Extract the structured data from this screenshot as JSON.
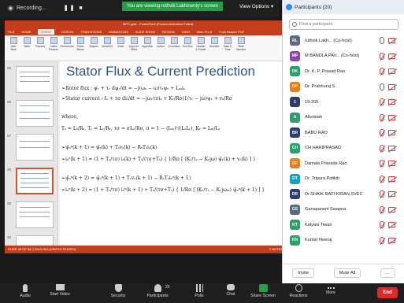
{
  "topbar": {
    "recording_label": "Recording...",
    "pause_stop": "❚❚ ■",
    "viewing_banner": "You are viewing ruthvik Lakhinenty's screen",
    "view_options": "View Options ▾"
  },
  "ppt": {
    "window_title": "MPC.pptx - PowerPoint (Product Activation Failed)",
    "tabs": [
      "FILE",
      "HOME",
      "INSERT",
      "DESIGN",
      "TRANSITIONS",
      "ANIMATIONS",
      "SLIDE SHOW",
      "REVIEW",
      "VIEW",
      "Nitro Pro 8",
      "Foxit Reader PDF"
    ],
    "active_tab": "INSERT",
    "ribbon_items": [
      "New Slide",
      "Table",
      "Pictures",
      "Online Pictures",
      "Screenshot",
      "Photo Album",
      "Shapes",
      "SmartArt",
      "Chart",
      "Apps for Office",
      "Hyperlink",
      "Action",
      "Comment",
      "Text Box",
      "Header & Footer",
      "WordArt",
      "Date & Time",
      "Slide Number"
    ],
    "slide_numbers": [
      "25",
      "26",
      "27",
      "28",
      "29",
      "30"
    ],
    "slide_title": "Stator Flux & Current Prediction",
    "eq_rotor": "➢Rotor flux : ψ̇ᵣ + τᵣ dψᵣ/dt = −j(ωₑ − ω)τᵣψᵣ + Lₘiₛ",
    "eq_stator": "➢Stator current : Iₛ + τσ diₛ/dt = −jωₑτσiₛ + Kᵣ/Rσ(1/τᵣ − jω)ψᵣ + vₛ/Rσ",
    "where": "where,",
    "eq_defs": "Tₛ = Lₛ/Rₛ, Tᵣ = Lᵣ/Rᵣ, τσ = σLₛ/Rσ, σ = 1 − (Lₘ)²/(LₛLᵣ), Kᵣ = Lₘ/Lᵣ",
    "eq_1": "➢ψ̂ₛᵖ(k + 1) = ψ̂ₛ(k) + Tₛvₛ(k) − RₛTₛiₛ(k)",
    "eq_2": "➢iₛᵖ(k + 1) = (1 + Tₛ/τσ) iₛ(k) + Tₛ/(τσ+Tₛ) { 1/Rσ [ (Kᵣ/τᵣ − Kᵣjω) ψ̂ᵣ(k) + vₛ(k) ] }",
    "eq_3": "➢ψ̂ₛᵖ(k + 2) = ψ̂ₛᵖ(k + 1) + Tₛvₛ(k + 1) − RₛTₛiₛᵖ(k + 1)",
    "eq_4": "➢iₛᵖ(k + 2) = (1 + Tₛ/τσ) iₛᵖ(k + 1) + Tₛ/(τσ+Tₛ) { 1/Rσ [ (Kᵣ/τᵣ − Kᵣjωₘ) ψ̂ᵣᵖ(k + 1) ] }",
    "status_bar": "SLIDE 28 OF 56   ▯   ENGLISH (UNITED STATES)",
    "notes": "≡ NOTES"
  },
  "panel": {
    "title": "Participants (20)",
    "search_placeholder": "Find a participant",
    "invite": "Invite",
    "mute_all": "Mute All",
    "more": "...",
    "participants": [
      {
        "initials": "RL",
        "name": "ruthvik Lakh... (Co-host)",
        "color": "#5b6b7f",
        "mic": "on"
      },
      {
        "initials": "MP",
        "name": "M BANDLA PAV... (Co-host)",
        "color": "#8e44ad",
        "mic": "off"
      },
      {
        "initials": "DK",
        "name": "Dr. K. P. Prasad Rao",
        "color": "#2e9e6a",
        "mic": "off"
      },
      {
        "initials": "DP",
        "name": "Dr. Prabhuraj S",
        "color": "#e67e22",
        "mic": "on"
      },
      {
        "initials": "1",
        "name": "19-205",
        "color": "#2c3e70",
        "mic": "off"
      },
      {
        "initials": "A",
        "name": "Afiuraiah",
        "color": "#2e9e6a",
        "mic": "off"
      },
      {
        "initials": "BR",
        "name": "BABU RAO",
        "color": "#2c3e70",
        "mic": "off"
      },
      {
        "initials": "CH",
        "name": "CH HARIPRASAD",
        "color": "#2e9e6a",
        "mic": "off"
      },
      {
        "initials": "DP",
        "name": "Damala Prasada Rao",
        "color": "#e67e22",
        "mic": "off"
      },
      {
        "initials": "DT",
        "name": "Dr. Tripura Pidikiti",
        "color": "#17a2b8",
        "mic": "off"
      },
      {
        "initials": "DR",
        "name": "Dr.SHAIK RAFI KIRAN,SVEC",
        "color": "#2c3e70",
        "mic": "off"
      },
      {
        "initials": "GS",
        "name": "Ganapaneni Swapna",
        "color": "#5b6b7f",
        "mic": "off"
      },
      {
        "initials": "KT",
        "name": "Kalyani Tiwari",
        "color": "#2e9e6a",
        "mic": "off"
      },
      {
        "initials": "KN",
        "name": "Kumar Neeraj",
        "color": "#2e9e6a",
        "mic": "off"
      }
    ]
  },
  "toolbar": {
    "audio": "Audio",
    "start_video": "Start Video",
    "security": "Security",
    "participants": "Participants",
    "participants_count": "20",
    "polls": "Polls",
    "chat": "Chat",
    "share_screen": "Share Screen",
    "reactions": "Reactions",
    "more": "More",
    "end": "End"
  },
  "colors": {
    "accent_green": "#23a047",
    "ppt_red": "#c43e1c",
    "title_blue": "#2c5288",
    "end_red": "#e02828"
  }
}
